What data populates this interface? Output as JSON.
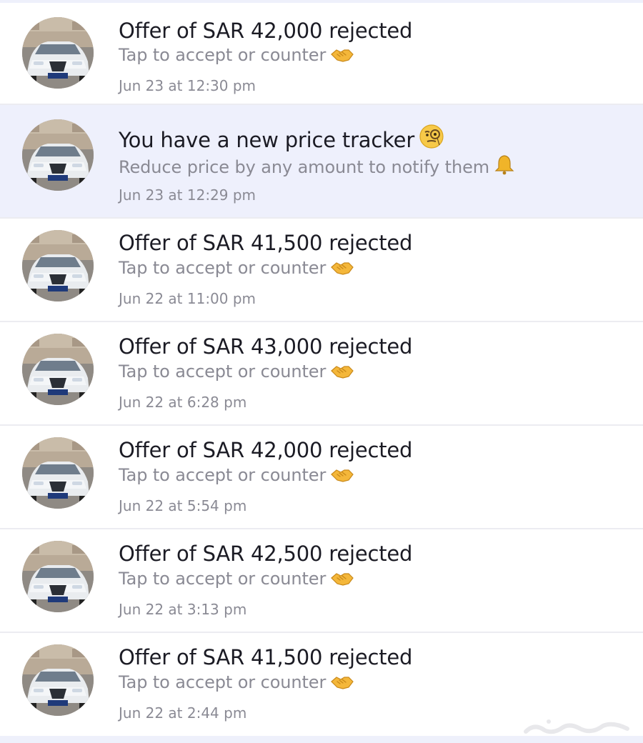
{
  "notifications": [
    {
      "title": "Offer of SAR 42,000 rejected",
      "subtitle": "Tap to accept or counter",
      "emoji": "handshake-icon",
      "time": "Jun 23 at 12:30 pm",
      "highlighted": false
    },
    {
      "title": "You have a new price tracker",
      "title_emoji": "monocle-face-icon",
      "subtitle": "Reduce price by any amount to notify them",
      "emoji": "bell-icon",
      "time": "Jun 23 at 12:29 pm",
      "highlighted": true
    },
    {
      "title": "Offer of SAR 41,500 rejected",
      "subtitle": "Tap to accept or counter",
      "emoji": "handshake-icon",
      "time": "Jun 22 at 11:00 pm",
      "highlighted": false
    },
    {
      "title": "Offer of SAR 43,000 rejected",
      "subtitle": "Tap to accept or counter",
      "emoji": "handshake-icon",
      "time": "Jun 22 at 6:28 pm",
      "highlighted": false
    },
    {
      "title": "Offer of SAR 42,000 rejected",
      "subtitle": "Tap to accept or counter",
      "emoji": "handshake-icon",
      "time": "Jun 22 at 5:54 pm",
      "highlighted": false
    },
    {
      "title": "Offer of SAR 42,500 rejected",
      "subtitle": "Tap to accept or counter",
      "emoji": "handshake-icon",
      "time": "Jun 22 at 3:13 pm",
      "highlighted": false
    },
    {
      "title": "Offer of SAR 41,500 rejected",
      "subtitle": "Tap to accept or counter",
      "emoji": "handshake-icon",
      "time": "Jun 22 at 2:44 pm",
      "highlighted": false
    }
  ],
  "colors": {
    "highlight_background": "#eef0fc",
    "title": "#1b1b24",
    "secondary_text": "#8a8a94",
    "divider": "#ececf1"
  },
  "watermark": "حراج"
}
